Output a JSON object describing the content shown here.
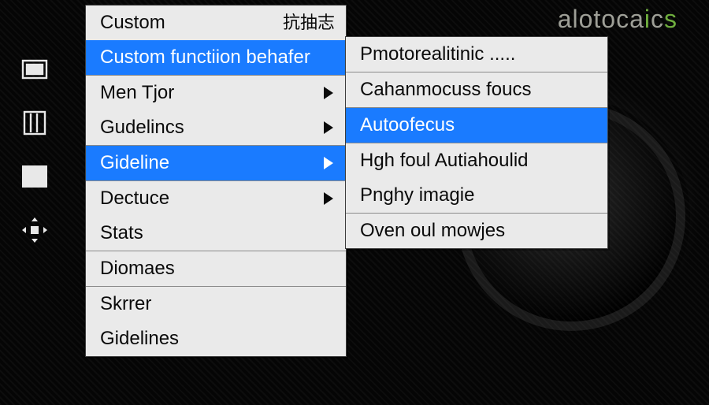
{
  "brand": {
    "pre": "alotoca",
    "accent1": "i",
    "mid": "c",
    "accent2": "s"
  },
  "rail": [
    "rectangle-icon",
    "columns-icon",
    "forward-icon",
    "grid-move-icon"
  ],
  "menu1": {
    "groups": [
      {
        "items": [
          {
            "id": "custom",
            "label": "Custom",
            "extra": "抗抽志",
            "arrow": false,
            "sel": false
          },
          {
            "id": "custom-fn",
            "label": "Custom functiion behafer",
            "arrow": false,
            "sel": true
          }
        ]
      },
      {
        "items": [
          {
            "id": "men-tjor",
            "label": "Men Tjor",
            "arrow": true,
            "sel": false
          },
          {
            "id": "guidelines-a",
            "label": "Gudelincs",
            "arrow": true,
            "sel": false
          }
        ]
      },
      {
        "items": [
          {
            "id": "gideline",
            "label": "Gideline",
            "arrow": true,
            "sel": true
          }
        ]
      },
      {
        "items": [
          {
            "id": "dectuce",
            "label": "Dectuce",
            "arrow": true,
            "sel": false
          },
          {
            "id": "stats",
            "label": "Stats",
            "arrow": false,
            "sel": false
          }
        ]
      },
      {
        "items": [
          {
            "id": "diomaes",
            "label": "Diomaes",
            "arrow": false,
            "sel": false
          }
        ]
      },
      {
        "items": [
          {
            "id": "skrrer",
            "label": "Skrrer",
            "arrow": false,
            "sel": false
          },
          {
            "id": "gidelines-b",
            "label": "Gidelines",
            "arrow": false,
            "sel": false
          }
        ]
      }
    ]
  },
  "menu2": {
    "groups": [
      {
        "items": [
          {
            "id": "photoreal",
            "label": "Pmotorealitinic .....",
            "sel": false
          }
        ]
      },
      {
        "items": [
          {
            "id": "cahan",
            "label": "Cahanmocuss foucs",
            "sel": false
          }
        ]
      },
      {
        "items": [
          {
            "id": "autofocus",
            "label": "Autoofecus",
            "sel": true
          }
        ]
      },
      {
        "items": [
          {
            "id": "hghfoul",
            "label": "Hgh foul Autiahoulid",
            "sel": false
          },
          {
            "id": "pnghy",
            "label": "Pnghy imagie",
            "sel": false
          }
        ]
      },
      {
        "items": [
          {
            "id": "oven",
            "label": "Oven oul mowjes",
            "sel": false
          }
        ]
      }
    ]
  }
}
